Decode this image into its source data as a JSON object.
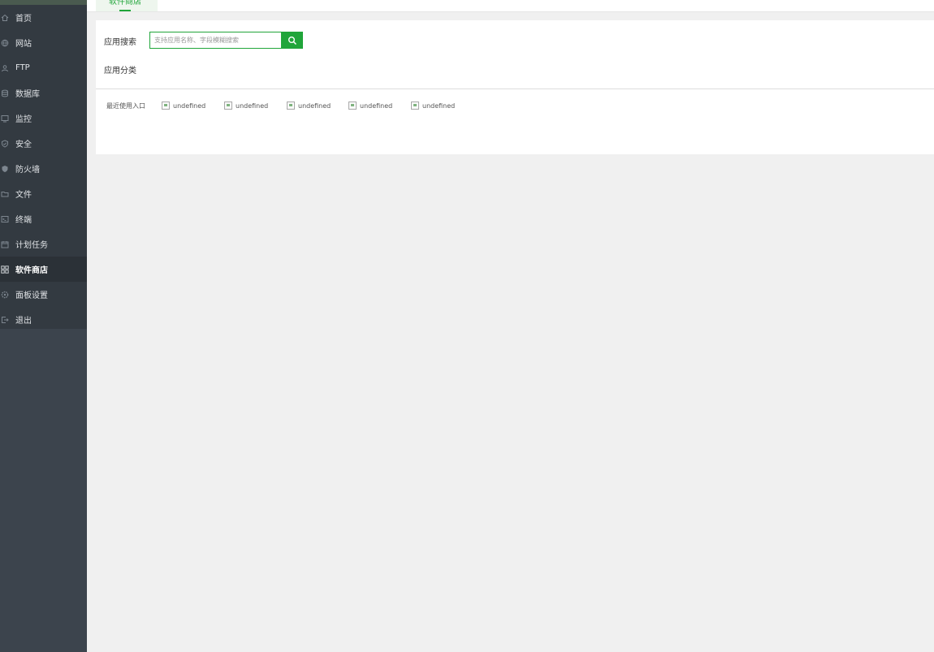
{
  "sidebar": {
    "items": [
      {
        "label": "首页",
        "icon": "home-icon"
      },
      {
        "label": "网站",
        "icon": "globe-icon"
      },
      {
        "label": "FTP",
        "icon": "ftp-icon"
      },
      {
        "label": "数据库",
        "icon": "database-icon"
      },
      {
        "label": "监控",
        "icon": "monitor-icon"
      },
      {
        "label": "安全",
        "icon": "shield-check-icon"
      },
      {
        "label": "防火墙",
        "icon": "firewall-icon"
      },
      {
        "label": "文件",
        "icon": "folder-icon"
      },
      {
        "label": "终端",
        "icon": "terminal-icon"
      },
      {
        "label": "计划任务",
        "icon": "calendar-icon"
      },
      {
        "label": "软件商店",
        "icon": "grid-icon",
        "active": true
      },
      {
        "label": "面板设置",
        "icon": "gear-icon"
      },
      {
        "label": "退出",
        "icon": "logout-icon"
      }
    ]
  },
  "tabs": [
    {
      "label": "软件商店",
      "active": true
    }
  ],
  "search": {
    "label": "应用搜索",
    "placeholder": "支持应用名称、字段模糊搜索",
    "value": ""
  },
  "category": {
    "label": "应用分类"
  },
  "recent": {
    "label": "最近使用入口",
    "items": [
      "undefined",
      "undefined",
      "undefined",
      "undefined",
      "undefined"
    ]
  },
  "colors": {
    "accent": "#20a53a",
    "sidebar_bg": "#3c444d",
    "nav_bg": "#333a41",
    "nav_active_bg": "#2b3137",
    "page_bg": "#f0f0f0"
  }
}
